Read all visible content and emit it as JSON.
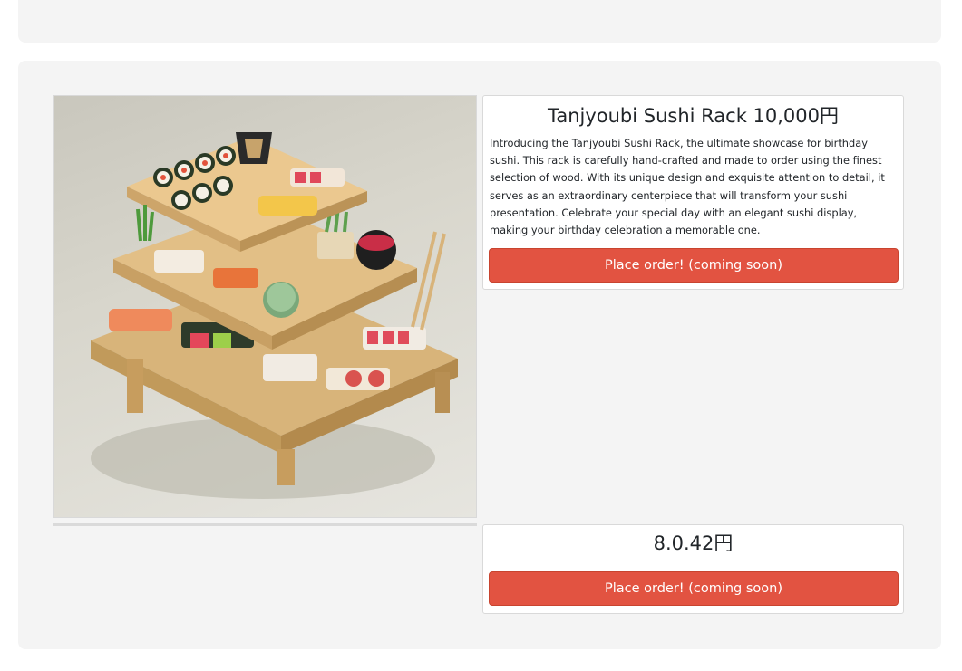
{
  "products": [
    {
      "title": "Tanjyoubi Sushi Rack 10,000円",
      "description": "Introducing the Tanjyoubi Sushi Rack, the ultimate showcase for birthday sushi. This rack is carefully hand-crafted and made to order using the finest selection of wood. With its unique design and exquisite attention to detail, it serves as an extraordinary centerpiece that will transform your sushi presentation. Celebrate your special day with an elegant sushi display, making your birthday celebration a memorable one.",
      "button_label": "Place order! (coming soon)"
    },
    {
      "title": "8.0.42円",
      "button_label": "Place order! (coming soon)"
    }
  ],
  "colors": {
    "button": "#e25341",
    "card_background": "#f4f4f4"
  }
}
